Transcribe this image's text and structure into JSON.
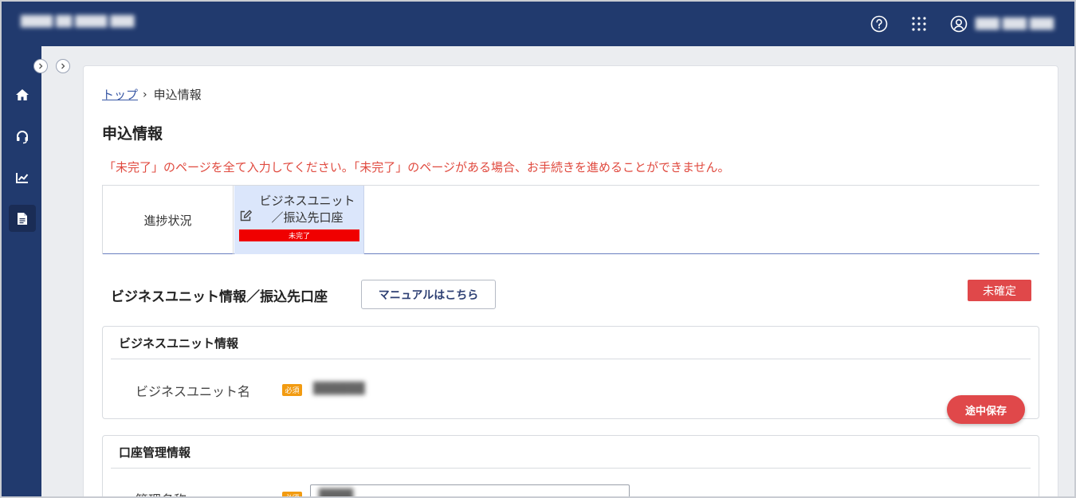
{
  "header": {
    "app_title": "████ ██ ████ ███",
    "user_name": "███ ███ ███"
  },
  "sidebar": {
    "items": [
      {
        "icon": "home-icon"
      },
      {
        "icon": "support-icon"
      },
      {
        "icon": "chart-icon"
      },
      {
        "icon": "document-icon",
        "active": true
      }
    ]
  },
  "breadcrumb": {
    "home": "トップ",
    "separator": "›",
    "current": "申込情報"
  },
  "page": {
    "title": "申込情報",
    "warning": "「未完了」のページを全て入力してください。「未完了」のページがある場合、お手続きを進めることができません。"
  },
  "progress": {
    "label": "進捗状況",
    "steps": [
      {
        "line1": "ビジネスユニット",
        "line2": "／振込先口座",
        "status": "未完了"
      }
    ]
  },
  "section": {
    "title": "ビジネスユニット情報／振込先口座",
    "manual_button": "マニュアルはこちら",
    "status": "未確定"
  },
  "panels": {
    "business_unit": {
      "title": "ビジネスユニット情報",
      "field_label": "ビジネスユニット名",
      "required": "必須",
      "value": "██████"
    },
    "account": {
      "title": "口座管理情報",
      "field_label": "管理名称",
      "required": "必須",
      "value": "████"
    }
  },
  "actions": {
    "save": "途中保存"
  },
  "colors": {
    "header_bg": "#213a6e",
    "accent_red": "#e0484a",
    "required_orange": "#f29b11",
    "step_active_bg": "#dbe6fb",
    "warning_text": "#e04a3f"
  }
}
